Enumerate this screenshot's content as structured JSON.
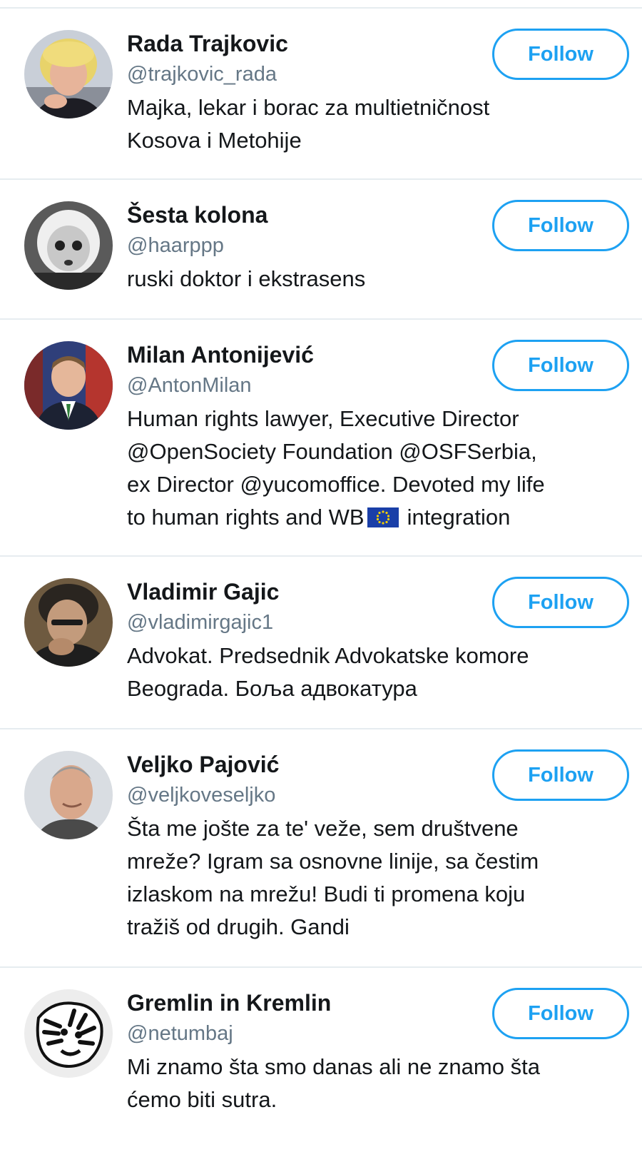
{
  "follow_label": "Follow",
  "colors": {
    "accent": "#1da1f2",
    "handle": "#657786",
    "divider": "#e6ecf0",
    "text": "#14171a"
  },
  "accounts": [
    {
      "name": "Rada Trajkovic",
      "handle": "@trajkovic_rada",
      "bio_lines": [
        "Majka, lekar i borac za multietničnost",
        "Kosova i Metohije"
      ],
      "avatar": "photo-blonde-woman"
    },
    {
      "name": "Šesta kolona",
      "handle": "@haarppp",
      "bio_lines": [
        "ruski doktor i ekstrasens"
      ],
      "avatar": "photo-bw-child"
    },
    {
      "name": "Milan Antonijević",
      "handle": "@AntonMilan",
      "bio_lines": [
        "Human rights lawyer, Executive Director",
        "@OpenSociety Foundation @OSFSerbia,",
        "ex Director @yucomoffice. Devoted my life",
        "to human rights and WB",
        "integration"
      ],
      "bio_icon": "eu-flag-icon",
      "avatar": "photo-man-suit"
    },
    {
      "name": "Vladimir Gajic",
      "handle": "@vladimirgajic1",
      "bio_lines": [
        "Advokat. Predsednik Advokatske komore",
        "Beograda. Боља адвокатура"
      ],
      "avatar": "photo-man-dark"
    },
    {
      "name": "Veljko Pajović",
      "handle": "@veljkoveseljko",
      "bio_lines": [
        "Šta me jošte za te' veže, sem društvene",
        "mreže? Igram sa osnovne linije, sa čestim",
        "izlaskom na mrežu! Budi ti promena koju",
        "tražiš od drugih. Gandi"
      ],
      "avatar": "photo-bald-man"
    },
    {
      "name": "Gremlin in Kremlin",
      "handle": "@netumbaj",
      "bio_lines": [
        "Mi znamo šta smo danas ali ne znamo šta",
        "ćemo biti sutra."
      ],
      "avatar": "tiger-drawing"
    }
  ]
}
